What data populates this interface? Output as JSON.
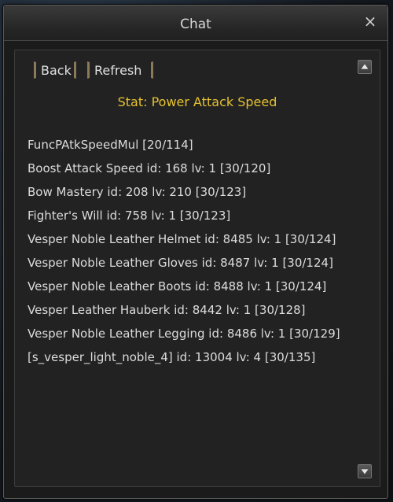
{
  "window": {
    "title": "Chat"
  },
  "toolbar": {
    "back_label": "Back",
    "refresh_label": "Refresh"
  },
  "icons": {
    "close": "×",
    "scroll_up": "arrow-up",
    "scroll_down": "arrow-down"
  },
  "stat": {
    "title": "Stat: Power Attack Speed",
    "color": "#e6c230"
  },
  "entries": [
    {
      "text": "FuncPAtkSpeedMul [20/114]"
    },
    {
      "text": "Boost Attack Speed id: 168 lv: 1 [30/120]"
    },
    {
      "text": "Bow Mastery id: 208 lv: 210 [30/123]"
    },
    {
      "text": "Fighter's Will id: 758 lv: 1 [30/123]"
    },
    {
      "text": "Vesper Noble Leather Helmet id: 8485 lv: 1 [30/124]"
    },
    {
      "text": "Vesper Noble Leather Gloves id: 8487 lv: 1 [30/124]"
    },
    {
      "text": "Vesper Noble Leather Boots id: 8488 lv: 1 [30/124]"
    },
    {
      "text": "Vesper Leather Hauberk id: 8442 lv: 1 [30/128]"
    },
    {
      "text": "Vesper Noble Leather Legging id: 8486 lv: 1 [30/129]"
    },
    {
      "text": "[s_vesper_light_noble_4] id: 13004 lv: 4 [30/135]"
    }
  ]
}
